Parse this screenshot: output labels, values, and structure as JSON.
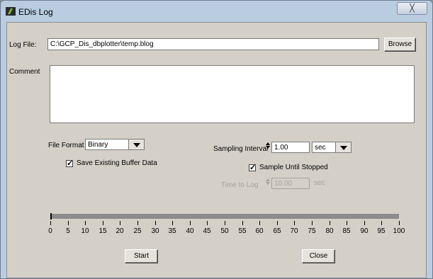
{
  "window": {
    "title": "EDis Log",
    "close_glyph": "╳"
  },
  "log_file": {
    "label": "Log File:",
    "value": "C:\\GCP_Dis_dbplotter\\temp.blog",
    "browse_label": "Browse"
  },
  "comment": {
    "label": "Comment",
    "value": ""
  },
  "file_format": {
    "label": "File Format",
    "selected": "Binary"
  },
  "save_existing": {
    "label": "Save Existing Buffer Data",
    "checked": true
  },
  "sampling_interval": {
    "label": "Sampling Interval",
    "value": "1.00",
    "unit": "sec"
  },
  "sample_until_stopped": {
    "label": "Sample Until Stopped",
    "checked": true
  },
  "time_to_log": {
    "label": "Time to Log",
    "value": "10.00",
    "unit": "sec",
    "enabled": false
  },
  "progress": {
    "value_percent": 0,
    "tick_labels": [
      "0",
      "5",
      "10",
      "15",
      "20",
      "25",
      "30",
      "35",
      "40",
      "45",
      "50",
      "55",
      "60",
      "65",
      "70",
      "75",
      "80",
      "85",
      "90",
      "95",
      "100"
    ]
  },
  "buttons": {
    "start": "Start",
    "close": "Close"
  },
  "colors": {
    "titlebar": "#b9cce0",
    "client": "#d4d0c8",
    "track": "#8c8c8c"
  }
}
